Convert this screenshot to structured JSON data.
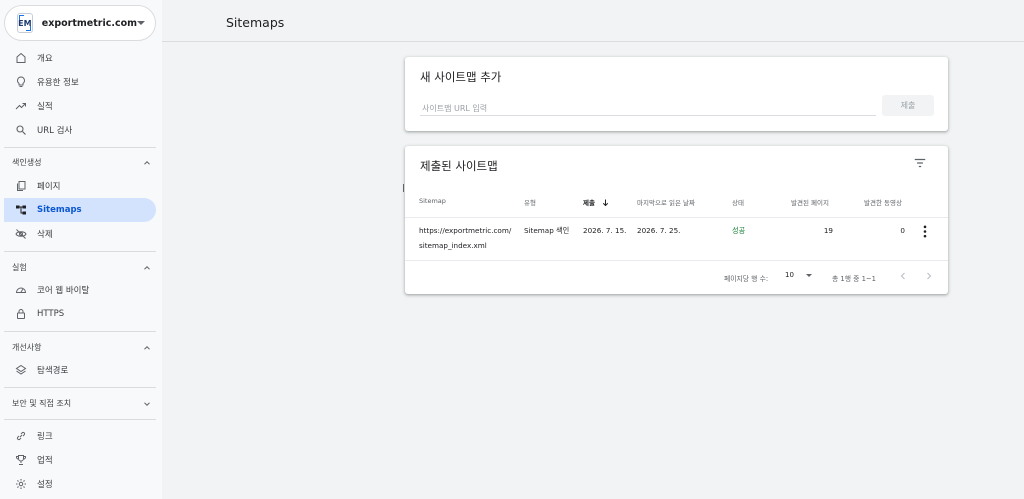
{
  "property": {
    "logo_text": "EM",
    "name": "exportmetric.com"
  },
  "nav": {
    "overview": "개요",
    "insights": "유용한 정보",
    "performance": "실적",
    "url_inspection": "URL 검사",
    "indexing": {
      "heading": "색인생성",
      "pages": "페이지",
      "sitemaps": "Sitemaps",
      "removals": "삭제"
    },
    "experience": {
      "heading": "실험",
      "core_web_vitals": "코어 웹 바이탈",
      "https": "HTTPS"
    },
    "enhancements": {
      "heading": "개선사항",
      "breadcrumbs": "탐색경로"
    },
    "security": {
      "heading": "보안 및 직접 조치"
    },
    "links": "링크",
    "achievements": "업적",
    "settings": "설정"
  },
  "header": {
    "title": "Sitemaps"
  },
  "add_sitemap": {
    "title": "새 사이트맵 추가",
    "placeholder": "사이트맵 URL 입력",
    "submit_label": "제출"
  },
  "submitted": {
    "title": "제출된 사이트맵",
    "columns": {
      "sitemap": "Sitemap",
      "type": "유형",
      "submitted": "제출",
      "last_read": "마지막으로 읽은 날짜",
      "status": "상태",
      "discovered_pages": "발견된 페이지",
      "discovered_videos": "발견한 동영상"
    },
    "rows": [
      {
        "url_line1": "https://exportmetric.com/",
        "url_line2": "sitemap_index.xml",
        "type": "Sitemap 색인",
        "submitted": "2026. 7. 15.",
        "last_read": "2026. 7. 25.",
        "status": "성공",
        "pages": "19",
        "videos": "0"
      }
    ],
    "footer": {
      "rows_per_page_label": "페이지당 행 수:",
      "rows_per_page_value": "10",
      "range": "총 1행 중 1~1"
    }
  },
  "colors": {
    "accent": "#0b57d0",
    "active_bg": "#d3e3fd",
    "success": "#188038"
  }
}
